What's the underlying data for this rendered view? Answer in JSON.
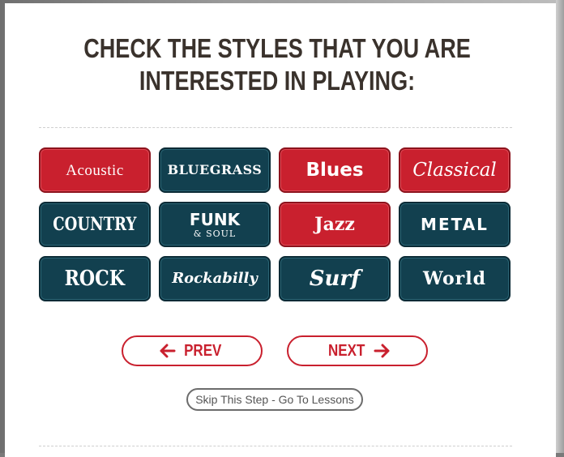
{
  "heading": {
    "line1": "CHECK THE STYLES THAT YOU ARE",
    "line2": "INTERESTED IN PLAYING:"
  },
  "styles": [
    {
      "label": "Acoustic",
      "checked": true
    },
    {
      "label": "BLUEGRASS",
      "checked": false
    },
    {
      "label": "Blues",
      "checked": true
    },
    {
      "label": "Classical",
      "checked": true
    },
    {
      "label": "COUNTRY",
      "checked": false
    },
    {
      "label": "FUNK",
      "sublabel": "& SOUL",
      "checked": false
    },
    {
      "label": "Jazz",
      "checked": true
    },
    {
      "label": "METAL",
      "checked": false
    },
    {
      "label": "ROCK",
      "checked": false
    },
    {
      "label": "Rockabilly",
      "checked": false
    },
    {
      "label": "Surf",
      "checked": false
    },
    {
      "label": "World",
      "checked": false
    }
  ],
  "nav": {
    "prev_label": "PREV",
    "next_label": "NEXT",
    "prev_icon": "arrow-left-icon",
    "next_icon": "arrow-right-icon"
  },
  "skip": {
    "label": "Skip This Step - Go To Lessons"
  },
  "colors": {
    "checked": "#c9202e",
    "unchecked": "#12404f",
    "accent": "#c9202e",
    "heading": "#3a322c"
  }
}
